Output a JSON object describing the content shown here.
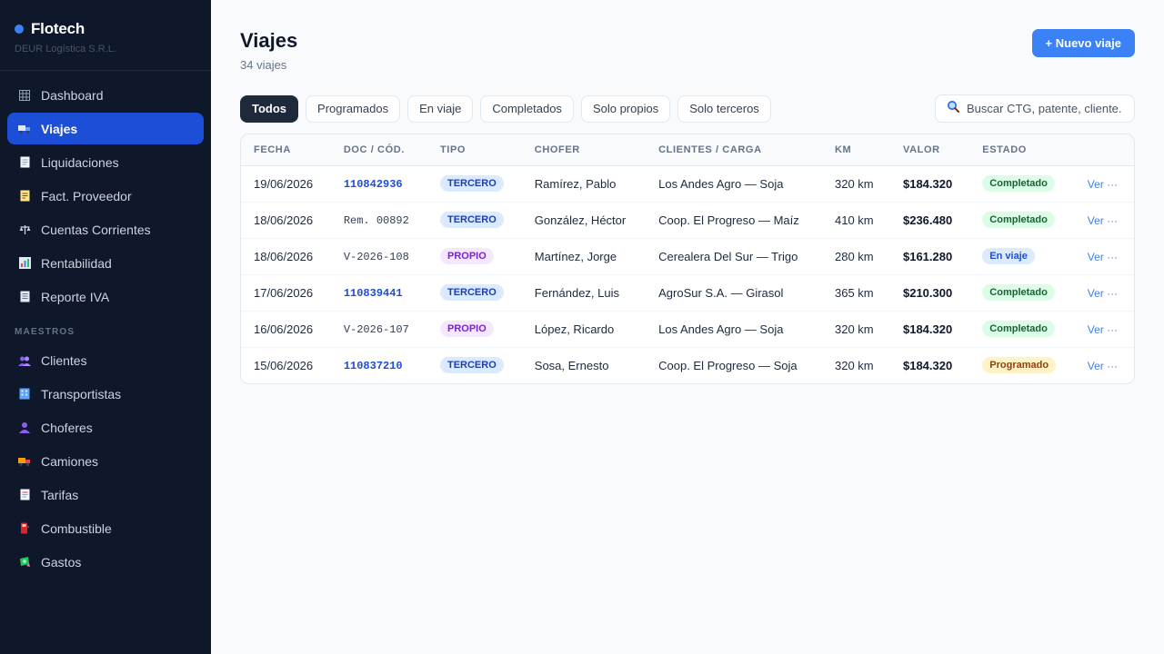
{
  "brand": {
    "name": "Flotech",
    "subtitle": "DEUR Logística S.R.L."
  },
  "nav": {
    "items": [
      {
        "label": "Dashboard",
        "icon": "grid-icon",
        "active": false
      },
      {
        "label": "Viajes",
        "icon": "truck-icon",
        "active": true
      },
      {
        "label": "Liquidaciones",
        "icon": "document-icon",
        "active": false
      },
      {
        "label": "Fact. Proveedor",
        "icon": "receipt-icon",
        "active": false
      },
      {
        "label": "Cuentas Corrientes",
        "icon": "scale-icon",
        "active": false
      },
      {
        "label": "Rentabilidad",
        "icon": "bar-chart-icon",
        "active": false
      },
      {
        "label": "Reporte IVA",
        "icon": "report-icon",
        "active": false
      }
    ],
    "section_label": "MAESTROS",
    "master_items": [
      {
        "label": "Clientes",
        "icon": "users-icon"
      },
      {
        "label": "Transportistas",
        "icon": "building-icon"
      },
      {
        "label": "Choferes",
        "icon": "person-icon"
      },
      {
        "label": "Camiones",
        "icon": "delivery-truck-icon"
      },
      {
        "label": "Tarifas",
        "icon": "price-list-icon"
      },
      {
        "label": "Combustible",
        "icon": "fuel-pump-icon"
      },
      {
        "label": "Gastos",
        "icon": "money-icon"
      }
    ]
  },
  "header": {
    "title": "Viajes",
    "subtitle": "34 viajes",
    "new_button": "+ Nuevo viaje"
  },
  "filters": [
    "Todos",
    "Programados",
    "En viaje",
    "Completados",
    "Solo propios",
    "Solo terceros"
  ],
  "search": {
    "placeholder": "Buscar CTG, patente, cliente..."
  },
  "table": {
    "columns": [
      "FECHA",
      "DOC / CÓD.",
      "TIPO",
      "CHOFER",
      "CLIENTES / CARGA",
      "KM",
      "VALOR",
      "ESTADO",
      ""
    ],
    "rows": [
      {
        "fecha": "19/06/2026",
        "doc": "110842936",
        "doc_link": true,
        "tipo": "TERCERO",
        "chofer": "Ramírez, Pablo",
        "carga": "Los Andes Agro — Soja",
        "km": "320 km",
        "valor": "$184.320",
        "estado": "Completado",
        "accion": "Ver ···"
      },
      {
        "fecha": "18/06/2026",
        "doc": "Rem. 00892",
        "doc_link": false,
        "tipo": "TERCERO",
        "chofer": "González, Héctor",
        "carga": "Coop. El Progreso — Maíz",
        "km": "410 km",
        "valor": "$236.480",
        "estado": "Completado",
        "accion": "Ver ···"
      },
      {
        "fecha": "18/06/2026",
        "doc": "V-2026-108",
        "doc_link": false,
        "tipo": "PROPIO",
        "chofer": "Martínez, Jorge",
        "carga": "Cerealera Del Sur — Trigo",
        "km": "280 km",
        "valor": "$161.280",
        "estado": "En viaje",
        "accion": "Ver ···"
      },
      {
        "fecha": "17/06/2026",
        "doc": "110839441",
        "doc_link": true,
        "tipo": "TERCERO",
        "chofer": "Fernández, Luis",
        "carga": "AgroSur S.A. — Girasol",
        "km": "365 km",
        "valor": "$210.300",
        "estado": "Completado",
        "accion": "Ver ···"
      },
      {
        "fecha": "16/06/2026",
        "doc": "V-2026-107",
        "doc_link": false,
        "tipo": "PROPIO",
        "chofer": "López, Ricardo",
        "carga": "Los Andes Agro — Soja",
        "km": "320 km",
        "valor": "$184.320",
        "estado": "Completado",
        "accion": "Ver ···"
      },
      {
        "fecha": "15/06/2026",
        "doc": "110837210",
        "doc_link": true,
        "tipo": "TERCERO",
        "chofer": "Sosa, Ernesto",
        "carga": "Coop. El Progreso — Soja",
        "km": "320 km",
        "valor": "$184.320",
        "estado": "Programado",
        "accion": "Ver ···"
      }
    ]
  },
  "colors": {
    "sidebar_bg": "#0f172a",
    "accent": "#3b82f6",
    "active_nav": "#1d4ed8"
  }
}
